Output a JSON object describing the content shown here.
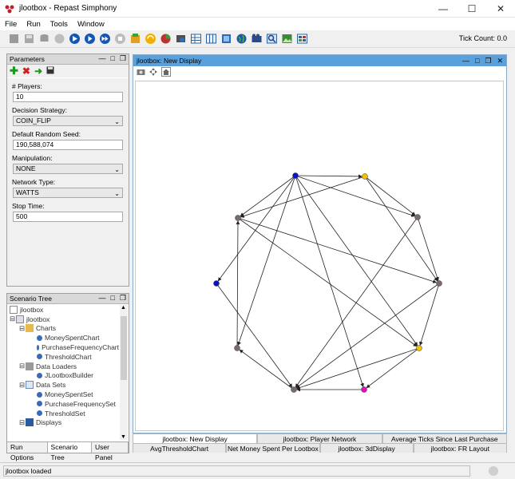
{
  "window": {
    "title": "jlootbox - Repast Simphony"
  },
  "menu": [
    "File",
    "Run",
    "Tools",
    "Window"
  ],
  "toolbar": {
    "tick_count": "Tick Count: 0.0"
  },
  "parameters": {
    "title": "Parameters",
    "fields": [
      {
        "label": "# Players:",
        "value": "10",
        "type": "input"
      },
      {
        "label": "Decision Strategy:",
        "value": "COIN_FLIP",
        "type": "select"
      },
      {
        "label": "Default Random Seed:",
        "value": "190,588,074",
        "type": "input"
      },
      {
        "label": "Manipulation:",
        "value": "NONE",
        "type": "select"
      },
      {
        "label": "Network Type:",
        "value": "WATTS",
        "type": "select"
      },
      {
        "label": "Stop Time:",
        "value": "500",
        "type": "input"
      }
    ]
  },
  "scenario_tree": {
    "title": "Scenario Tree",
    "items": [
      "jlootbox",
      "jlootbox",
      "Charts",
      "MoneySpentChart",
      "PurchaseFrequencyChart",
      "ThresholdChart",
      "Data Loaders",
      "JLootboxBuilder",
      "Data Sets",
      "MoneySpentSet",
      "PurchaseFrequencySet",
      "ThresholdSet",
      "Displays"
    ],
    "tabs": [
      "Run Options",
      "Scenario Tree",
      "User Panel"
    ]
  },
  "display": {
    "title": "jlootbox: New Display",
    "tabs_row1": [
      "jlootbox: New Display",
      "jlootbox: Player Network",
      "Average Ticks Since Last Purchase"
    ],
    "tabs_row2": [
      "AvgThresholdChart",
      "Net Money Spent Per Lootbox",
      "jlootbox: 3dDisplay",
      "jlootbox: FR Layout"
    ]
  },
  "status": {
    "text": "jlootbox loaded"
  },
  "colors": {
    "accent": "#5aa0da",
    "node_blue": "#1010c8",
    "node_yellow": "#f2c200",
    "node_magenta": "#e010c0",
    "node_gray": "#7a6a6a"
  }
}
